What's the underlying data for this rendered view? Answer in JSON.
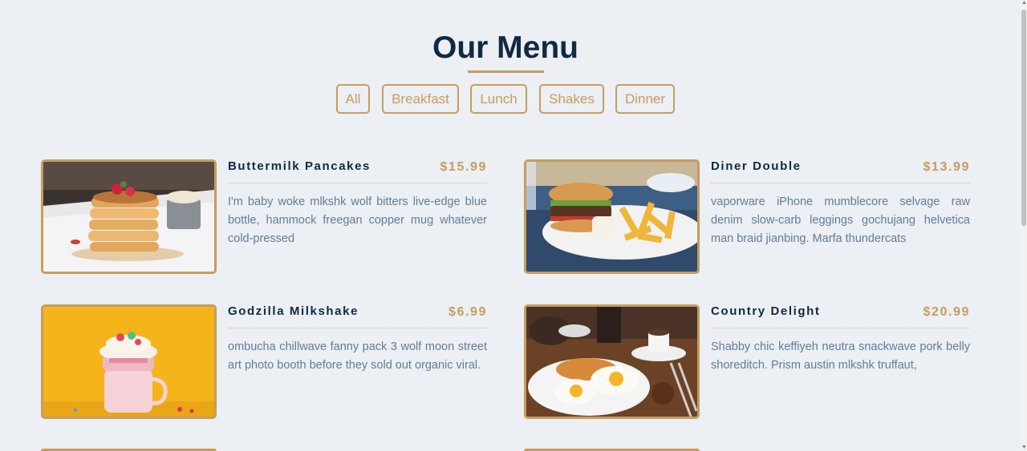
{
  "header": {
    "title": "Our Menu"
  },
  "filters": [
    "All",
    "Breakfast",
    "Lunch",
    "Shakes",
    "Dinner"
  ],
  "menu": [
    {
      "name": "Buttermilk Pancakes",
      "price": "$15.99",
      "desc": "I'm baby woke mlkshk wolf bitters live-edge blue bottle, hammock freegan copper mug whatever cold-pressed",
      "image": "pancakes-photo"
    },
    {
      "name": "Diner Double",
      "price": "$13.99",
      "desc": "vaporware iPhone mumblecore selvage raw denim slow-carb leggings gochujang helvetica man braid jianbing. Marfa thundercats",
      "image": "burger-photo"
    },
    {
      "name": "Godzilla Milkshake",
      "price": "$6.99",
      "desc": "ombucha chillwave fanny pack 3 wolf moon street art photo booth before they sold out organic viral.",
      "image": "milkshake-photo"
    },
    {
      "name": "Country Delight",
      "price": "$20.99",
      "desc": "Shabby chic keffiyeh neutra snackwave pork belly shoreditch. Prism austin mlkshk truffaut,",
      "image": "breakfast-plate-photo"
    }
  ],
  "colors": {
    "accent": "#c59d5f",
    "heading": "#102a43",
    "text": "#617d98",
    "background": "#eceff3"
  }
}
